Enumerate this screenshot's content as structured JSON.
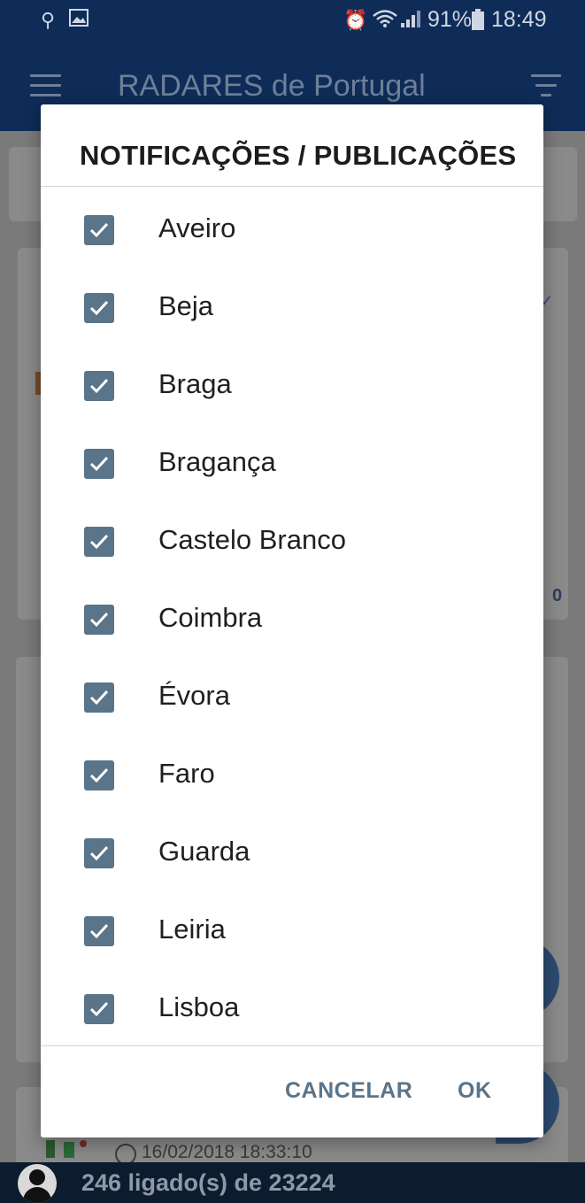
{
  "status_bar": {
    "battery": "91%",
    "time": "18:49"
  },
  "app_bar": {
    "title": "RADARES de Portugal"
  },
  "background": {
    "timestamp": "16/02/2018 18:33:10",
    "count_badge": "0"
  },
  "bottom_bar": {
    "online_text": "246 ligado(s) de 23224"
  },
  "dialog": {
    "title": "NOTIFICAÇÕES / PUBLICAÇÕES",
    "items": [
      {
        "label": "Aveiro",
        "checked": true
      },
      {
        "label": "Beja",
        "checked": true
      },
      {
        "label": "Braga",
        "checked": true
      },
      {
        "label": "Bragança",
        "checked": true
      },
      {
        "label": "Castelo Branco",
        "checked": true
      },
      {
        "label": "Coimbra",
        "checked": true
      },
      {
        "label": "Évora",
        "checked": true
      },
      {
        "label": "Faro",
        "checked": true
      },
      {
        "label": "Guarda",
        "checked": true
      },
      {
        "label": "Leiria",
        "checked": true
      },
      {
        "label": "Lisboa",
        "checked": true
      }
    ],
    "cancel_label": "CANCELAR",
    "ok_label": "OK"
  },
  "colors": {
    "primary_dark": "#0e2c57",
    "checkbox": "#5a7489",
    "button_text": "#5a7489"
  }
}
